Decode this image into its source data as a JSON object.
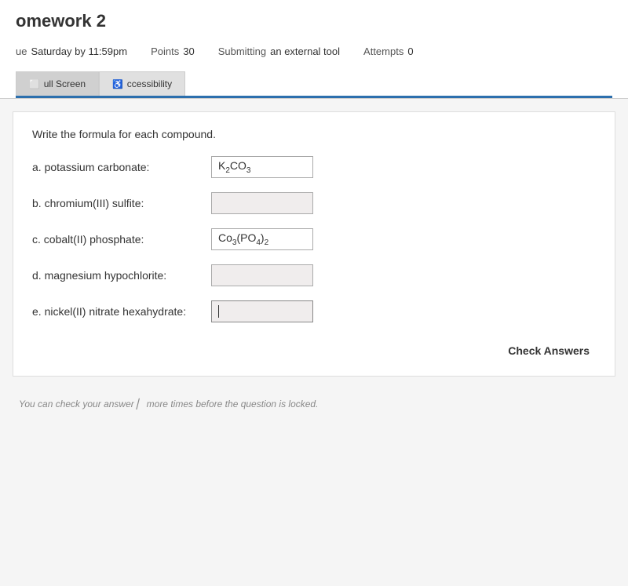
{
  "page": {
    "title": "omework 2",
    "meta": {
      "due_label": "ue",
      "due_value": "Saturday by 11:59pm",
      "points_label": "Points",
      "points_value": "30",
      "submitting_label": "Submitting",
      "submitting_value": "an external tool",
      "attempts_label": "Attempts",
      "attempts_value": "0"
    },
    "tabs": [
      {
        "label": "ull Screen",
        "icon": "⬜"
      },
      {
        "label": "ccessibility",
        "icon": "♿"
      }
    ],
    "question": {
      "prompt": "Write the formula for each compound.",
      "compounds": [
        {
          "id": "a",
          "label": "a. potassium carbonate:",
          "formula_html": "K<sub>2</sub>CO<sub>3</sub>",
          "value": "K₂CO₃",
          "has_value": true
        },
        {
          "id": "b",
          "label": "b. chromium(III) sulfite:",
          "formula_html": "",
          "value": "",
          "has_value": false
        },
        {
          "id": "c",
          "label": "c. cobalt(II) phosphate:",
          "formula_html": "Co<sub>3</sub>(PO<sub>4</sub>)<sub>2</sub>",
          "value": "Co₃(PO₄)₂",
          "has_value": true
        },
        {
          "id": "d",
          "label": "d. magnesium hypochlorite:",
          "formula_html": "",
          "value": "",
          "has_value": false
        },
        {
          "id": "e",
          "label": "e. nickel(II) nitrate hexahydrate:",
          "formula_html": "",
          "value": "",
          "has_value": false,
          "focused": true
        }
      ],
      "check_answers_label": "Check Answers",
      "footer_note": "You can check your answer ▏ more times before the question is locked."
    }
  }
}
